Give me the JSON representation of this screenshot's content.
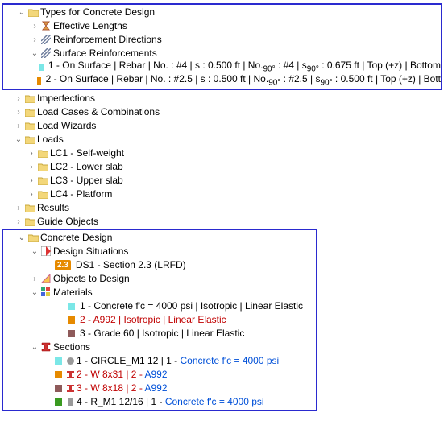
{
  "box1": {
    "typesForConcreteDesign": "Types for Concrete Design",
    "effectiveLengths": "Effective Lengths",
    "reinforcementDirections": "Reinforcement Directions",
    "surfaceReinforcements": "Surface Reinforcements",
    "sr1": {
      "label": "1 - On Surface | Rebar | No. : #4 | s : 0.500 ft | No.",
      "sub": "90°",
      "tail": " : #4 | s",
      "sub2": "90°",
      "tail2": " : 0.675 ft | Top (+z) | Bottom",
      "swatch": "#7be7e7"
    },
    "sr2": {
      "label": "2 - On Surface | Rebar | No. : #2.5 | s : 0.500 ft | No.",
      "sub": "90°",
      "tail": " : #2.5 | s",
      "sub2": "90°",
      "tail2": " : 0.500 ft | Top (+z) | Bott",
      "swatch": "#e68a00"
    }
  },
  "mid": {
    "imperfections": "Imperfections",
    "loadCasesCombos": "Load Cases & Combinations",
    "loadWizards": "Load Wizards",
    "loads": "Loads",
    "lc1": "LC1 - Self-weight",
    "lc2": "LC2 - Lower slab",
    "lc3": "LC3 - Upper slab",
    "lc4": "LC4 - Platform",
    "results": "Results",
    "guideObjects": "Guide Objects"
  },
  "box2": {
    "concreteDesign": "Concrete Design",
    "designSituations": "Design Situations",
    "dsBadge": "2.3",
    "ds1": "DS1 - Section 2.3 (LRFD)",
    "objectsToDesign": "Objects to Design",
    "materials": "Materials",
    "mat1": {
      "swatch": "#7be7e7",
      "text": "1 - Concrete f'c = 4000 psi | Isotropic | Linear Elastic"
    },
    "mat2": {
      "swatch": "#e68a00",
      "text": "2 - A992 | Isotropic | Linear Elastic"
    },
    "mat3": {
      "swatch": "#8e5a5a",
      "text": "3 - Grade 60 | Isotropic | Linear Elastic"
    },
    "sections": "Sections",
    "sec1": {
      "a": "1 - CIRCLE_M1 12 | 1 - ",
      "b": "Concrete f'c = 4000 psi"
    },
    "sec2": {
      "a": "2 - W 8x31 | 2 - ",
      "b": "A992"
    },
    "sec3": {
      "a": "3 - W 8x18 | 2 - ",
      "b": "A992"
    },
    "sec4": {
      "a": "4 - R_M1 12/16 | 1 - ",
      "b": "Concrete f'c = 4000 psi"
    }
  }
}
